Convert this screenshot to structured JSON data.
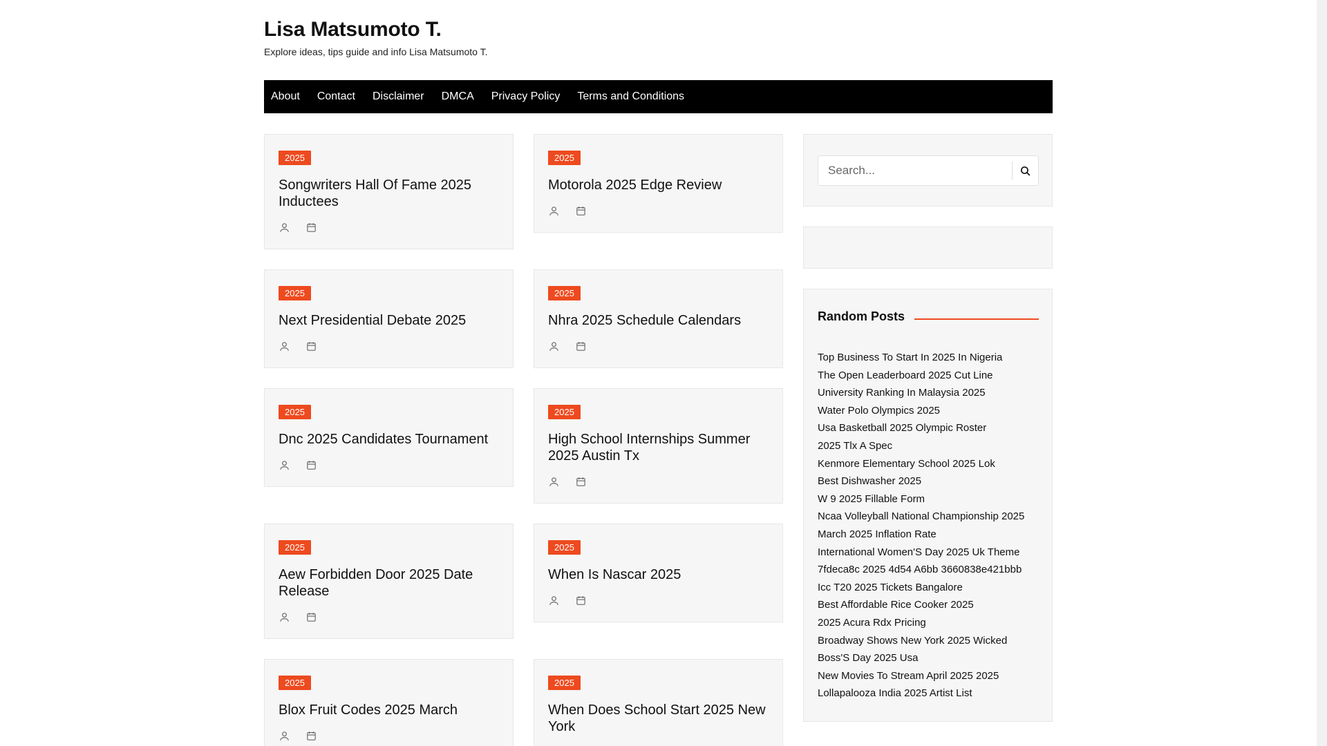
{
  "header": {
    "title": "Lisa Matsumoto T.",
    "description": "Explore ideas, tips guide and info Lisa Matsumoto T."
  },
  "nav": {
    "items": [
      "About",
      "Contact",
      "Disclaimer",
      "DMCA",
      "Privacy Policy",
      "Terms and Conditions"
    ]
  },
  "posts": [
    {
      "category": "2025",
      "title": "Songwriters Hall Of Fame 2025 Inductees"
    },
    {
      "category": "2025",
      "title": "Motorola 2025 Edge Review"
    },
    {
      "category": "2025",
      "title": "Next Presidential Debate 2025"
    },
    {
      "category": "2025",
      "title": "Nhra 2025 Schedule Calendars"
    },
    {
      "category": "2025",
      "title": "Dnc 2025 Candidates Tournament"
    },
    {
      "category": "2025",
      "title": "High School Internships Summer 2025 Austin Tx"
    },
    {
      "category": "2025",
      "title": "Aew Forbidden Door 2025 Date Release"
    },
    {
      "category": "2025",
      "title": "When Is Nascar 2025"
    },
    {
      "category": "2025",
      "title": "Blox Fruit Codes 2025 March"
    },
    {
      "category": "2025",
      "title": "When Does School Start 2025 New York"
    }
  ],
  "sidebar": {
    "search_placeholder": "Search...",
    "random_title": "Random Posts",
    "random_posts": [
      "Top Business To Start In 2025 In Nigeria",
      "The Open Leaderboard 2025 Cut Line",
      "University Ranking In Malaysia 2025",
      "Water Polo Olympics 2025",
      "Usa Basketball 2025 Olympic Roster",
      "2025 Tlx A Spec",
      "Kenmore Elementary School 2025 Lok",
      "Best Dishwasher 2025",
      "W 9 2025 Fillable Form",
      "Ncaa Volleyball National Championship 2025",
      "March 2025 Inflation Rate",
      "International Women'S Day 2025 Uk Theme",
      "7fdeca8c 2025 4d54 A6bb 3660838e421bbb",
      "Icc T20 2025 Tickets Bangalore",
      "Best Affordable Rice Cooker 2025",
      "2025 Acura Rdx Pricing",
      "Broadway Shows New York 2025 Wicked",
      "Boss'S Day 2025 Usa",
      "New Movies To Stream April 2025 2025",
      "Lollapalooza India 2025 Artist List"
    ]
  },
  "colors": {
    "accent": "#ee4a1f",
    "nav_bg": "#000000",
    "card_bg": "#f6f6f6"
  }
}
